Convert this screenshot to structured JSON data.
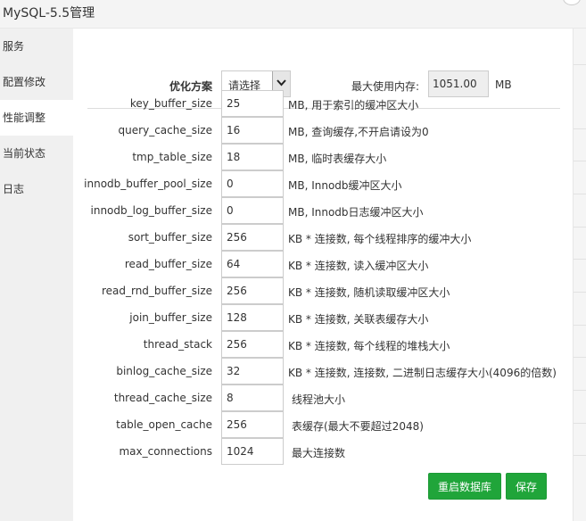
{
  "window": {
    "title": "MySQL-5.5管理"
  },
  "sidebar": {
    "items": [
      {
        "label": "服务",
        "active": false
      },
      {
        "label": "配置修改",
        "active": false
      },
      {
        "label": "性能调整",
        "active": true
      },
      {
        "label": "当前状态",
        "active": false
      },
      {
        "label": "日志",
        "active": false
      }
    ]
  },
  "header": {
    "plan_label": "优化方案",
    "plan_selected": "请选择",
    "mem_label": "最大使用内存:",
    "mem_value": "1051.00",
    "mem_unit": "MB"
  },
  "params": [
    {
      "name": "key_buffer_size",
      "value": "25",
      "desc": "MB, 用于索引的缓冲区大小"
    },
    {
      "name": "query_cache_size",
      "value": "16",
      "desc": "MB, 查询缓存,不开启请设为0"
    },
    {
      "name": "tmp_table_size",
      "value": "18",
      "desc": "MB, 临时表缓存大小"
    },
    {
      "name": "innodb_buffer_pool_size",
      "value": "0",
      "desc": "MB, Innodb缓冲区大小"
    },
    {
      "name": "innodb_log_buffer_size",
      "value": "0",
      "desc": "MB, Innodb日志缓冲区大小"
    },
    {
      "name": "sort_buffer_size",
      "value": "256",
      "desc": "KB * 连接数, 每个线程排序的缓冲大小"
    },
    {
      "name": "read_buffer_size",
      "value": "64",
      "desc": "KB * 连接数, 读入缓冲区大小"
    },
    {
      "name": "read_rnd_buffer_size",
      "value": "256",
      "desc": "KB * 连接数, 随机读取缓冲区大小"
    },
    {
      "name": "join_buffer_size",
      "value": "128",
      "desc": "KB * 连接数, 关联表缓存大小"
    },
    {
      "name": "thread_stack",
      "value": "256",
      "desc": "KB * 连接数, 每个线程的堆栈大小"
    },
    {
      "name": "binlog_cache_size",
      "value": "32",
      "desc": "KB * 连接数, 连接数, 二进制日志缓存大小(4096的倍数)"
    },
    {
      "name": "thread_cache_size",
      "value": "8",
      "desc": "线程池大小"
    },
    {
      "name": "table_open_cache",
      "value": "256",
      "desc": "表缓存(最大不要超过2048)"
    },
    {
      "name": "max_connections",
      "value": "1024",
      "desc": "最大连接数"
    }
  ],
  "buttons": {
    "restart": "重启数据库",
    "save": "保存"
  },
  "colors": {
    "accent": "#20a53a",
    "sidebar_bg": "#f0f0f0",
    "titlebar_bg": "#f4f4f4"
  }
}
